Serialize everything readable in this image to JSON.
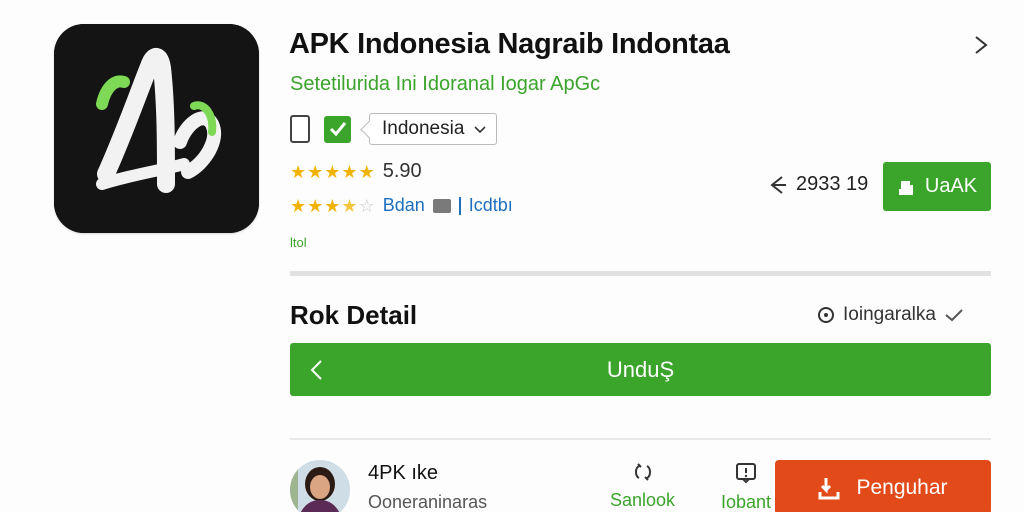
{
  "app": {
    "title": "APK Indonesia  Nagraib Indontaa",
    "subtitle": "Setetilurida Ini Idoranal  Iogar ApGc",
    "icon": "app-logo-icon"
  },
  "meta": {
    "language": "Indonesia",
    "icons": [
      "phone-icon",
      "check-icon",
      "chevron-down-icon"
    ]
  },
  "rating": {
    "score": "5.90",
    "stars_primary": 5,
    "stars_secondary": 3.5,
    "link_primary": "Bdan",
    "link_secondary": "Icdtbı",
    "tag": "ltol"
  },
  "stats": {
    "downloads": "2933 19",
    "install_label": "UaAK"
  },
  "detail": {
    "title": "Rok Detail",
    "status": "Ioingaralkа"
  },
  "unduh": {
    "label": "UnduŞ"
  },
  "author": {
    "name": "4PK ıke",
    "subtitle": "Ooneraninaras"
  },
  "actions": {
    "share_label": "Sanlook",
    "report_label": "Iobant",
    "primary_label": "Penguhar"
  },
  "colors": {
    "accent": "#3aa52a",
    "danger": "#e24a1a",
    "star": "#f2b300",
    "link": "#1f6fbf"
  }
}
